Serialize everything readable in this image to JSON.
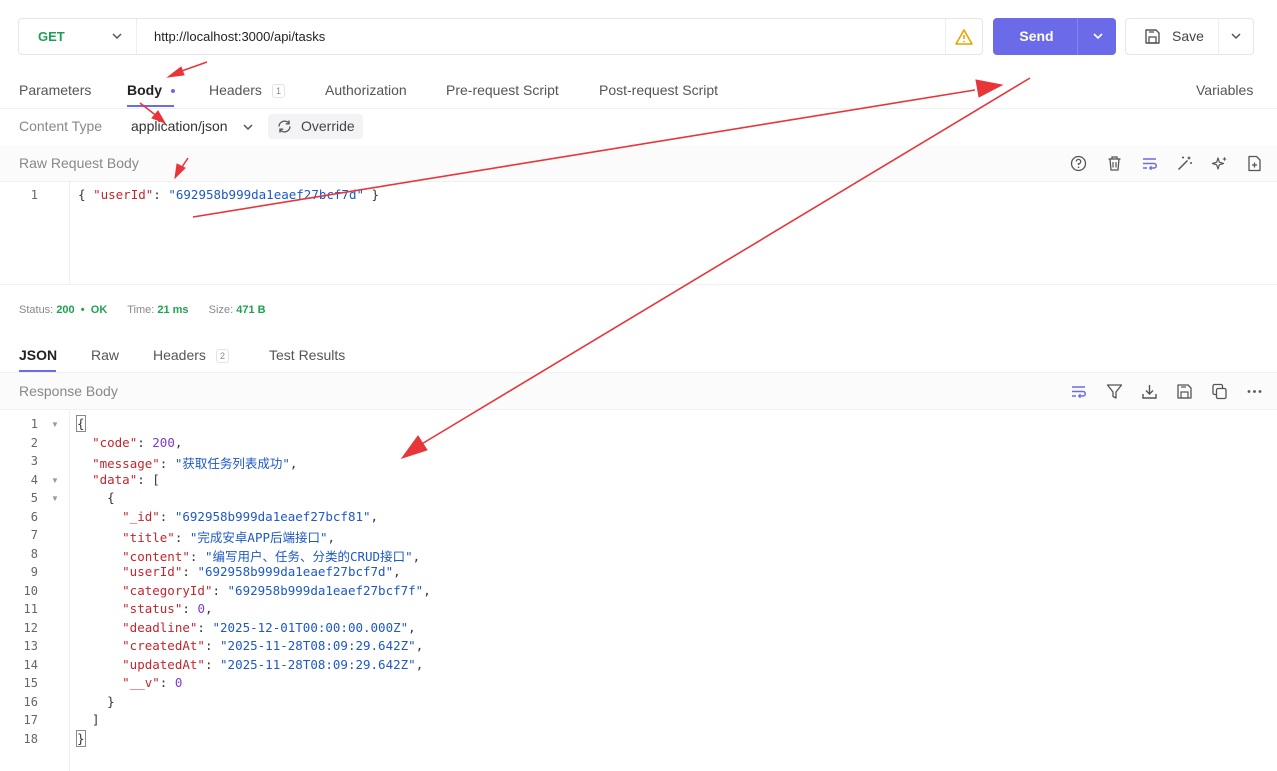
{
  "request": {
    "method": "GET",
    "url": "http://localhost:3000/api/tasks",
    "send_label": "Send",
    "save_label": "Save"
  },
  "tabs": [
    {
      "label": "Parameters"
    },
    {
      "label": "Body"
    },
    {
      "label": "Headers",
      "badge": "1"
    },
    {
      "label": "Authorization"
    },
    {
      "label": "Pre-request Script"
    },
    {
      "label": "Post-request Script"
    }
  ],
  "variables_label": "Variables",
  "content_type": {
    "label": "Content Type",
    "value": "application/json",
    "override_label": "Override"
  },
  "request_body": {
    "title": "Raw Request Body",
    "line_number": "1",
    "open": "{ ",
    "key": "\"userId\"",
    "colon": ": ",
    "value": "\"692958b999da1eaef27bcf7d\"",
    "close": " }"
  },
  "status": {
    "status_label": "Status:",
    "code": "200",
    "text": "OK",
    "time_label": "Time:",
    "time": "21 ms",
    "size_label": "Size:",
    "size": "471 B"
  },
  "response_tabs": [
    {
      "label": "JSON"
    },
    {
      "label": "Raw"
    },
    {
      "label": "Headers",
      "badge": "2"
    },
    {
      "label": "Test Results"
    }
  ],
  "response_body": {
    "title": "Response Body",
    "line_numbers": [
      "1",
      "2",
      "3",
      "4",
      "5",
      "6",
      "7",
      "8",
      "9",
      "10",
      "11",
      "12",
      "13",
      "14",
      "15",
      "16",
      "17",
      "18"
    ],
    "code": {
      "key": "\"code\"",
      "value": "200"
    },
    "message": {
      "key": "\"message\"",
      "value": "\"获取任务列表成功\""
    },
    "data_key": "\"data\"",
    "item": {
      "_id": "\"692958b999da1eaef27bcf81\"",
      "title": "\"完成安卓APP后端接口\"",
      "content": "\"编写用户、任务、分类的CRUD接口\"",
      "userId": "\"692958b999da1eaef27bcf7d\"",
      "categoryId": "\"692958b999da1eaef27bcf7f\"",
      "status": "0",
      "deadline": "\"2025-12-01T00:00:00.000Z\"",
      "createdAt": "\"2025-11-28T08:09:29.642Z\"",
      "updatedAt": "\"2025-11-28T08:09:29.642Z\"",
      "__v": "0"
    },
    "keys": {
      "_id": "\"_id\"",
      "title": "\"title\"",
      "content": "\"content\"",
      "userId": "\"userId\"",
      "categoryId": "\"categoryId\"",
      "status": "\"status\"",
      "deadline": "\"deadline\"",
      "createdAt": "\"createdAt\"",
      "updatedAt": "\"updatedAt\"",
      "__v": "\"__v\""
    }
  },
  "colors": {
    "accent": "#6b6ae8",
    "method_green": "#1e9e54",
    "status_green": "#1ea34f",
    "annotation_red": "#e8353a"
  }
}
